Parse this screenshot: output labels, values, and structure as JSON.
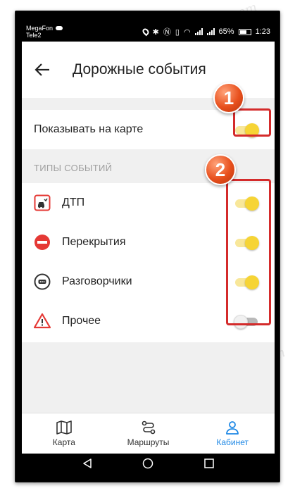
{
  "status_bar": {
    "carrier_1": "MegaFon",
    "carrier_2": "Tele2",
    "battery": "65%",
    "time": "1:23"
  },
  "app_bar": {
    "title": "Дорожные события"
  },
  "show_on_map": {
    "label": "Показывать на карте",
    "enabled": true
  },
  "section": {
    "header": "ТИПЫ СОБЫТИЙ"
  },
  "events": [
    {
      "label": "ДТП",
      "icon": "car-crash-icon",
      "enabled": true
    },
    {
      "label": "Перекрытия",
      "icon": "no-entry-icon",
      "enabled": true
    },
    {
      "label": "Разговорчики",
      "icon": "chat-bubble-icon",
      "enabled": true
    },
    {
      "label": "Прочее",
      "icon": "warning-triangle-icon",
      "enabled": false
    }
  ],
  "annotations": {
    "badge_1": "1",
    "badge_2": "2"
  },
  "bottom_nav": {
    "map": "Карта",
    "routes": "Маршруты",
    "cabinet": "Кабинет"
  },
  "colors": {
    "accent_blue": "#1e88e5",
    "toggle_on": "#f6d435",
    "annotation_red": "#d42b2b"
  },
  "watermark": "Soringpcrepair.com"
}
